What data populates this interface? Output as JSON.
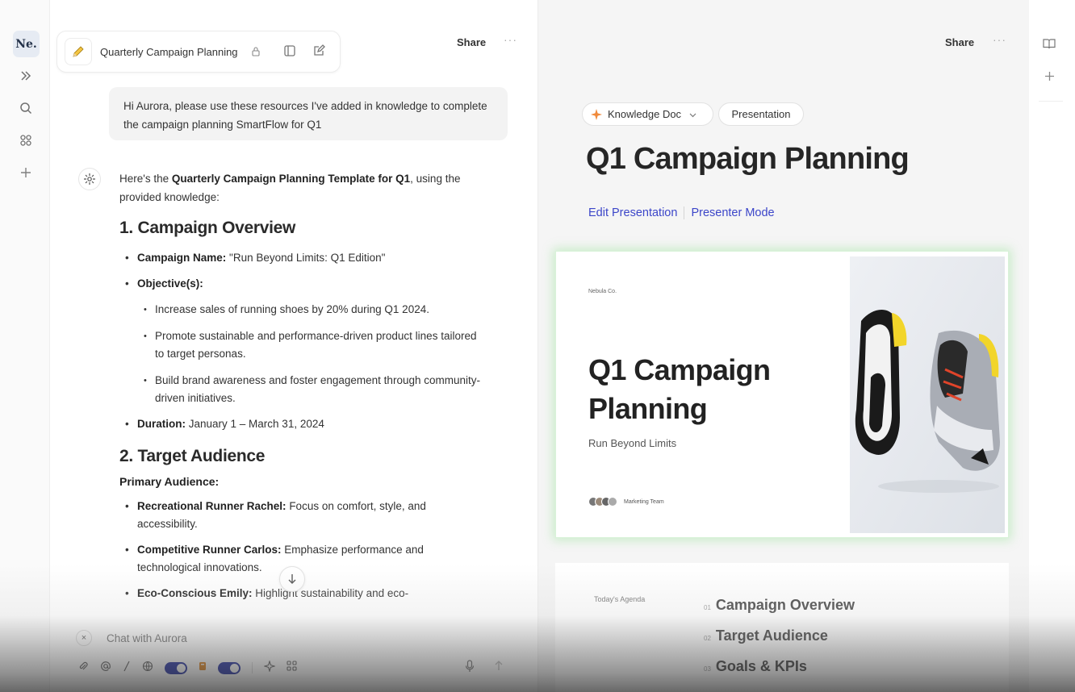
{
  "rail": {
    "logo": "Ne.",
    "icons": [
      "expand-icon",
      "search-icon",
      "apps-icon",
      "plus-icon"
    ]
  },
  "chat": {
    "tab_title": "Quarterly Campaign Planning",
    "share_label": "Share",
    "more_label": "···",
    "user_message": "Hi Aurora, please use these resources I've added in knowledge to complete the  campaign planning SmartFlow for Q1",
    "response": {
      "intro_prefix": "Here's the ",
      "intro_bold": "Quarterly Campaign Planning Template for Q1",
      "intro_suffix": ", using the provided knowledge:",
      "section1_title": "1. Campaign Overview",
      "campaign_name_label": "Campaign Name:",
      "campaign_name_value": " \"Run Beyond Limits: Q1 Edition\"",
      "objectives_label": "Objective(s):",
      "objectives": [
        "Increase sales of running shoes by 20% during Q1 2024.",
        "Promote sustainable and performance-driven product lines tailored to target personas.",
        "Build brand awareness and foster engagement through community-driven initiatives."
      ],
      "duration_label": "Duration:",
      "duration_value": " January 1 – March 31, 2024",
      "section2_title": "2. Target Audience",
      "primary_audience_label": "Primary Audience:",
      "personas": [
        {
          "name": "Recreational Runner Rachel:",
          "desc": " Focus on comfort, style, and accessibility."
        },
        {
          "name": "Competitive Runner Carlos:",
          "desc": " Emphasize performance and technological innovations."
        },
        {
          "name": "Eco-Conscious Emily:",
          "desc": " Highlight sustainability and eco-"
        }
      ]
    },
    "composer": {
      "placeholder": "Chat with Aurora",
      "close_label": "×"
    }
  },
  "doc": {
    "share_label": "Share",
    "more_label": "···",
    "pill_knowledge": "Knowledge Doc",
    "pill_presentation": "Presentation",
    "title": "Q1 Campaign Planning",
    "link_edit": "Edit Presentation",
    "link_presenter": "Presenter Mode",
    "slide1": {
      "brand": "Nebula Co.",
      "title_line1": "Q1 Campaign",
      "title_line2": "Planning",
      "subtitle": "Run Beyond Limits",
      "team": "Marketing Team"
    },
    "slide2": {
      "agenda_label": "Today's Agenda",
      "items": [
        {
          "num": "01",
          "label": "Campaign Overview"
        },
        {
          "num": "02",
          "label": "Target Audience"
        },
        {
          "num": "03",
          "label": "Goals & KPIs"
        }
      ]
    }
  },
  "colors": {
    "accent_blue": "#3c46c9",
    "toggle": "#2e3aa6",
    "slide_glow": "#78dc78",
    "spark_orange": "#f08a3c"
  }
}
